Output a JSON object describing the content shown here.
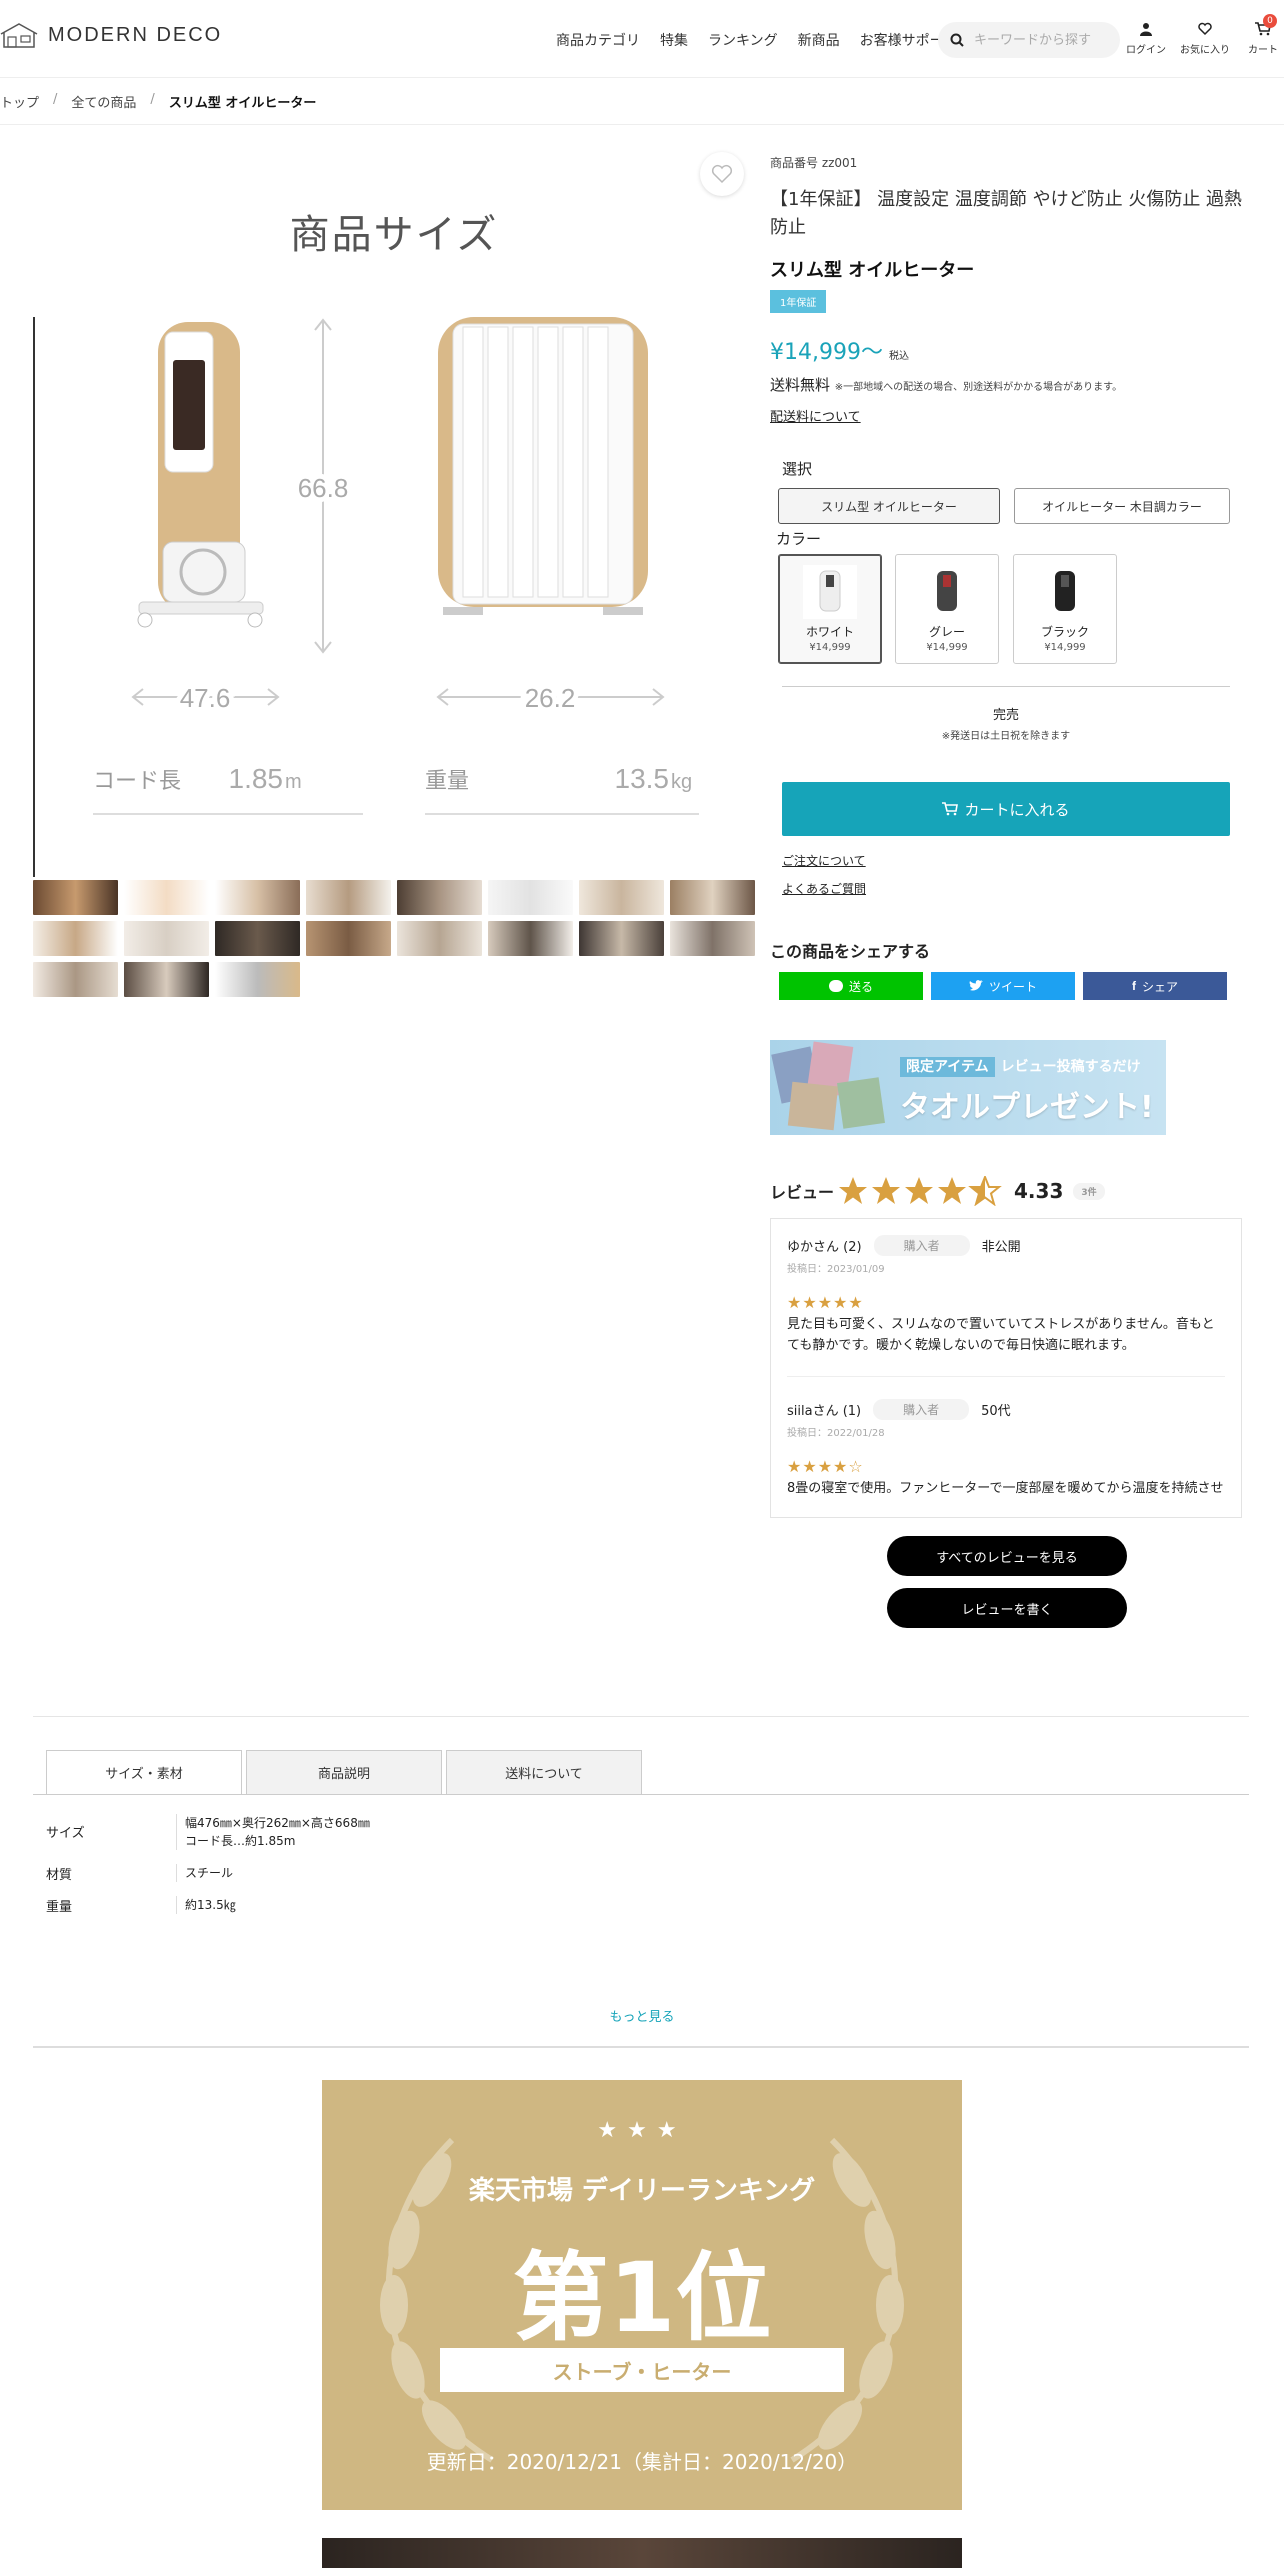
{
  "header": {
    "logo": "MODERN DECO",
    "nav": [
      "商品カテゴリ",
      "特集",
      "ランキング",
      "新商品",
      "お客様サポート"
    ],
    "search_placeholder": "キーワードから探す",
    "login": "ログイン",
    "favorites": "お気に入り",
    "cart": "カート",
    "cart_count": "0"
  },
  "breadcrumb": [
    "トップ",
    "全ての商品",
    "スリム型 オイルヒーター"
  ],
  "gallery": {
    "main_title": "商品サイズ",
    "height": "66.8",
    "width_a": "47.6",
    "width_b": "26.2",
    "cord_label": "コード長",
    "cord_value": "1.85",
    "cord_unit": "m",
    "weight_label": "重量",
    "weight_value": "13.5",
    "weight_unit": "kg"
  },
  "product": {
    "sku": "商品番号 zz001",
    "title": "【1年保証】 温度設定 温度調節 やけど防止 火傷防止 過熱防止",
    "subtitle": "スリム型 オイルヒーター",
    "badge": "1年保証",
    "price": "¥14,999～",
    "tax": "税込",
    "shipping": "送料無料",
    "shipping_note": "※一部地域への配送の場合、別途送料がかかる場合があります。",
    "shipping_link": "配送料について",
    "select_label": "選択",
    "options": [
      "スリム型 オイルヒーター",
      "オイルヒーター 木目調カラー"
    ],
    "color_label": "カラー",
    "colors": [
      {
        "name": "ホワイト",
        "price": "¥14,999"
      },
      {
        "name": "グレー",
        "price": "¥14,999"
      },
      {
        "name": "ブラック",
        "price": "¥14,999"
      }
    ],
    "stock": "完売",
    "stock_note": "※発送日は土日祝を除きます",
    "cart_button": "カートに入れる",
    "order_link": "ご注文について",
    "faq_link": "よくあるご質問"
  },
  "share": {
    "heading": "この商品をシェアする",
    "line": "送る",
    "twitter": "ツイート",
    "facebook": "シェア"
  },
  "campaign": {
    "tag": "限定アイテム",
    "line1": "レビュー投稿するだけ",
    "line2": "タオルプレゼント!"
  },
  "reviews": {
    "heading": "レビュー",
    "average": "4.33",
    "count": "3件",
    "items": [
      {
        "user": "ゆかさん (2)",
        "tag": "購入者",
        "extra": "非公開",
        "date": "投稿日：2023/01/09",
        "stars": "★★★★★",
        "body": "見た目も可愛く、スリムなので置いていてストレスがありません。音もとても静かです。暖かく乾燥しないので毎日快適に眠れます。"
      },
      {
        "user": "siilaさん (1)",
        "tag": "購入者",
        "extra": "50代",
        "date": "投稿日：2022/01/28",
        "stars": "★★★★☆",
        "body": "8畳の寝室で使用。ファンヒーターで一度部屋を暖めてから温度を持続させ"
      }
    ],
    "all_button": "すべてのレビューを見る",
    "write_button": "レビューを書く"
  },
  "tabs": [
    "サイズ・素材",
    "商品説明",
    "送料について"
  ],
  "specs": [
    {
      "key": "サイズ",
      "value1": "幅476㎜×奥行262㎜×高さ668㎜",
      "value2": "コード長…約1.85m"
    },
    {
      "key": "材質",
      "value1": "スチール",
      "value2": ""
    },
    {
      "key": "重量",
      "value1": "約13.5㎏",
      "value2": ""
    }
  ],
  "more": "もっと見る",
  "ranking": {
    "stars": "★★★",
    "line1": "楽天市場 デイリーランキング",
    "line2": "第1位",
    "category": "ストーブ・ヒーター",
    "updated": "更新日：2020/12/21（集計日：2020/12/20）"
  },
  "colors": {
    "accent": "#16a4b9",
    "line": "#00c300",
    "twitter": "#1da1f2",
    "facebook": "#3b5998",
    "star": "#d9a040",
    "gold": "#cfb782"
  }
}
